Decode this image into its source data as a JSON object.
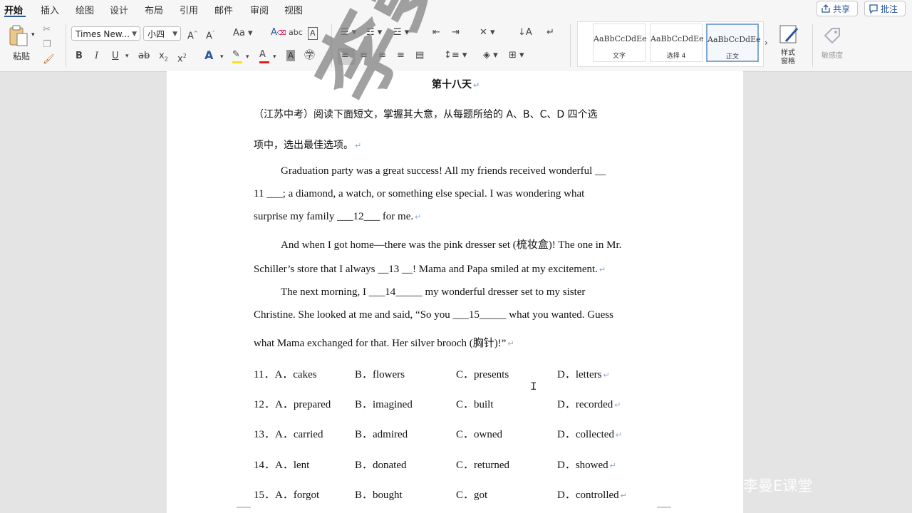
{
  "tabs": [
    "开始",
    "插入",
    "绘图",
    "设计",
    "布局",
    "引用",
    "邮件",
    "审阅",
    "视图"
  ],
  "top_buttons": {
    "share": "共享",
    "comment": "批注"
  },
  "ribbon": {
    "paste": "粘贴",
    "font_name": "Times New...",
    "font_size": "小四",
    "styles": [
      {
        "sample": "AaBbCcDdEe",
        "name": "文字"
      },
      {
        "sample": "AaBbCcDdEe",
        "name": "选择 4"
      },
      {
        "sample": "AaBbCcDdEe",
        "name": "正文"
      }
    ],
    "styles_pane": "样式\n窗格",
    "sensitivity": "敏感度",
    "accent_color": "#2b579a",
    "highlight_color": "#f5e21b",
    "font_color": "#e02020"
  },
  "document": {
    "title": "第十八天",
    "intro_line1": "（江苏中考）阅读下面短文，掌握其大意，从每题所给的 A、B、C、D 四个选",
    "intro_line2": "项中，选出最佳选项。",
    "passage": [
      "Graduation party was a great success! All my friends received wonderful __",
      "11 ___; a diamond, a watch, or something else special. I was wondering what",
      "surprise my family  ___12___  for me.",
      "And when I got home—there was the pink dresser set (梳妆盒)! The one in Mr.",
      "Schiller’s store that I always  __13 __! Mama and Papa smiled at my excitement.",
      "The next morning, I  ___14_____ my wonderful dresser set to my sister",
      "Christine. She looked at me and said, “So you  ___15_____  what you wanted. Guess",
      "what Mama exchanged for that. Her silver brooch (胸针)!”"
    ],
    "questions": [
      {
        "num": "11．A．cakes",
        "b": "B．flowers",
        "c": "C．presents",
        "d": "D．letters"
      },
      {
        "num": "12．A．prepared",
        "b": "B．imagined",
        "c": "C．built",
        "d": "D．recorded"
      },
      {
        "num": "13．A．carried",
        "b": "B．admired",
        "c": "C．owned",
        "d": "D．collected"
      },
      {
        "num": "14．A．lent",
        "b": "B．donated",
        "c": "C．returned",
        "d": "D．showed"
      },
      {
        "num": "15．A．forgot",
        "b": "B．bought",
        "c": "C．got",
        "d": "D．controlled"
      }
    ]
  },
  "watermark": "李曼E课堂",
  "corner_watermark": "李曼E课堂",
  "para_mark": "↵"
}
